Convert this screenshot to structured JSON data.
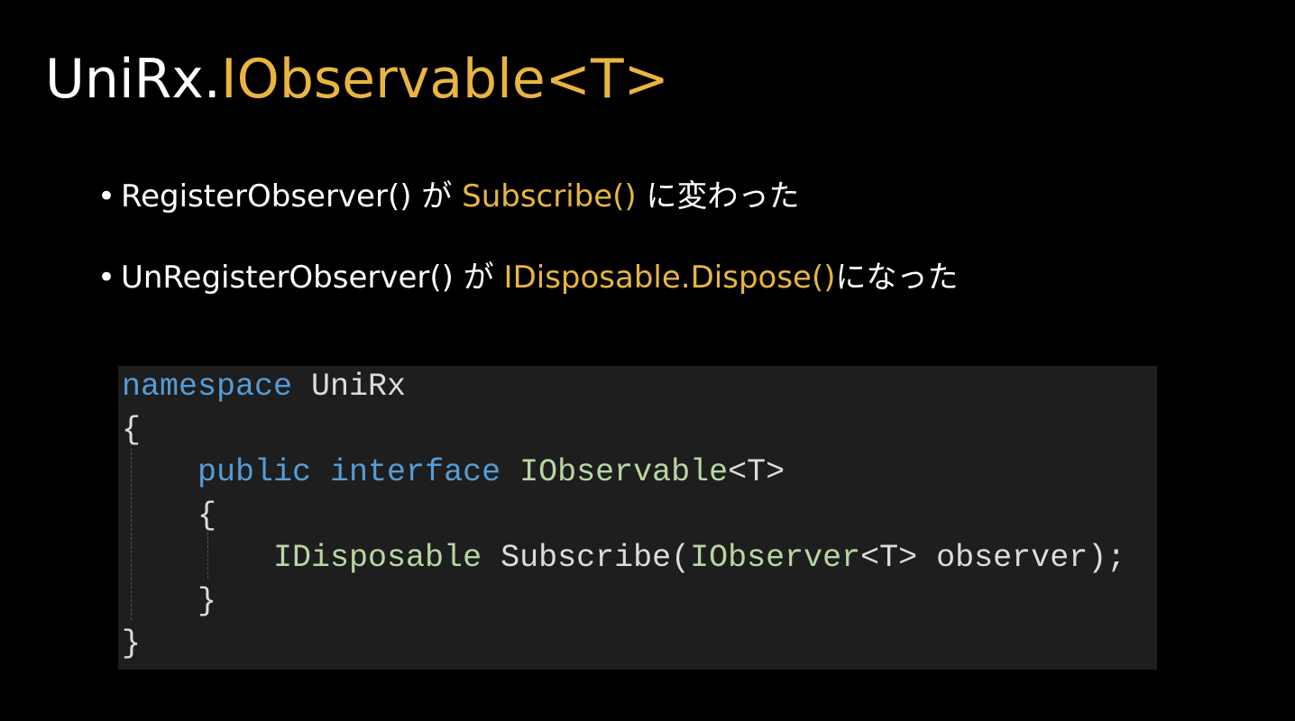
{
  "title": {
    "prefix": "UniRx.",
    "highlight": "IObservable<T>"
  },
  "bullets": [
    {
      "before": "RegisterObserver() が ",
      "highlight": "Subscribe()",
      "after": " に変わった"
    },
    {
      "before": "UnRegisterObserver() が ",
      "highlight": "IDisposable.Dispose()",
      "after": "になった"
    }
  ],
  "code": {
    "line1": {
      "kw": "namespace",
      "name": " UniRx"
    },
    "line2": "{",
    "line3": {
      "indent": "    ",
      "kw1": "public",
      "kw2": " interface",
      "type": " IObservable",
      "rest": "<T>"
    },
    "line4": "    {",
    "line5": {
      "indent": "        ",
      "type1": "IDisposable",
      "mid": " Subscribe(",
      "type2": "IObserver",
      "rest": "<T> observer);"
    },
    "line6": "    }",
    "line7": "}"
  },
  "colors": {
    "accent": "#e8b540",
    "keyword": "#569cd6",
    "type": "#b8d7a3",
    "code_bg": "#1e1e1e"
  }
}
